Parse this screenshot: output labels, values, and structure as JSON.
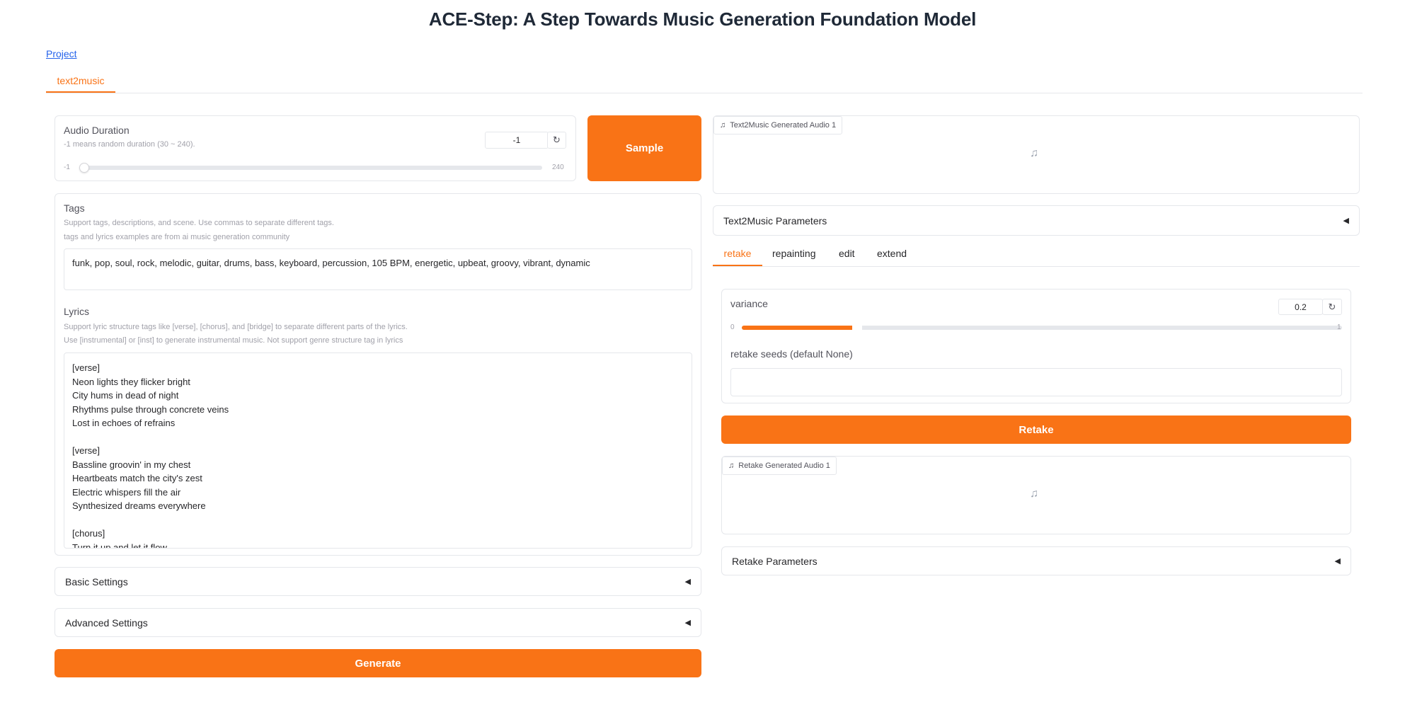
{
  "header": {
    "title": "ACE-Step: A Step Towards Music Generation Foundation Model"
  },
  "nav": {
    "project_link": "Project"
  },
  "main_tabs": [
    {
      "label": "text2music",
      "active": true
    }
  ],
  "left": {
    "duration": {
      "label": "Audio Duration",
      "info": "-1 means random duration (30 ~ 240).",
      "value": "-1",
      "min": "-1",
      "max": "240",
      "fraction": 0.0
    },
    "sample_button": "Sample",
    "tags": {
      "label": "Tags",
      "info1": "Support tags, descriptions, and scene. Use commas to separate different tags.",
      "info2": "tags and lyrics examples are from ai music generation community",
      "value": "funk, pop, soul, rock, melodic, guitar, drums, bass, keyboard, percussion, 105 BPM, energetic, upbeat, groovy, vibrant, dynamic"
    },
    "lyrics": {
      "label": "Lyrics",
      "info1": "Support lyric structure tags like [verse], [chorus], and [bridge] to separate different parts of the lyrics.",
      "info2": "Use [instrumental] or [inst] to generate instrumental music. Not support genre structure tag in lyrics",
      "lines": [
        "[verse]",
        "Neon lights they flicker bright",
        "City hums in dead of night",
        "Rhythms pulse through concrete veins",
        "Lost in echoes of refrains",
        "",
        "[verse]",
        "Bassline groovin' in my chest",
        "Heartbeats match the city's zest",
        "Electric whispers fill the air",
        "Synthesized dreams everywhere",
        "",
        "[chorus]",
        "Turn it up and let it flow"
      ]
    },
    "basic_settings": "Basic Settings",
    "advanced_settings": "Advanced Settings",
    "generate_button": "Generate"
  },
  "right": {
    "output_audio_label": "Text2Music Generated Audio 1",
    "params_accordion": "Text2Music Parameters",
    "sub_tabs": [
      {
        "label": "retake",
        "active": true
      },
      {
        "label": "repainting",
        "active": false
      },
      {
        "label": "edit",
        "active": false
      },
      {
        "label": "extend",
        "active": false
      }
    ],
    "variance": {
      "label": "variance",
      "value": "0.2",
      "min": "0",
      "max": "1",
      "fraction": 0.2
    },
    "retake_seeds": {
      "label": "retake seeds (default None)",
      "value": ""
    },
    "retake_button": "Retake",
    "retake_audio_label": "Retake Generated Audio 1",
    "retake_params_accordion": "Retake Parameters"
  },
  "colors": {
    "accent": "#f97316",
    "link": "#2563eb",
    "border": "#e5e7eb"
  },
  "icons": {
    "audio_tag": "music-note-icon",
    "empty_audio": "music-note-icon",
    "reset": "reset-icon",
    "collapse": "triangle-left-icon"
  }
}
